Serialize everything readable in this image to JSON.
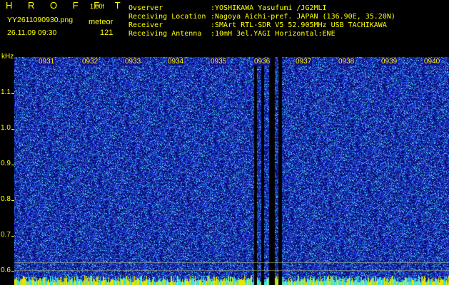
{
  "header": {
    "brand": "H R O F F T",
    "version": "1.00f",
    "filename": "YY2611090930.png",
    "observation_type": "meteor",
    "datetime": "26.11.09 09:30",
    "count": "121"
  },
  "info": [
    {
      "label": "Ovserver",
      "value": ":YOSHIKAWA Yasufumi /JG2MLI"
    },
    {
      "label": "Receiving Location",
      "value": ":Nagoya Aichi-pref. JAPAN (136.90E, 35.20N)"
    },
    {
      "label": "Receiver",
      "value": ":SMArt RTL-SDR V5 52.905MHz USB TACHIKAWA"
    },
    {
      "label": "Receiving Antenna",
      "value": ":10mH 3el.YAGI Horizontal:ENE"
    }
  ],
  "spectrogram": {
    "unit": "kHz",
    "y_labels": [
      "1.1",
      "1.0",
      "0.9",
      "0.8",
      "0.7",
      "0.6"
    ],
    "time_labels": [
      "0931",
      "0932",
      "0933",
      "0934",
      "0935",
      "0936",
      "0937",
      "0938",
      "0939",
      "0940"
    ],
    "colors": {
      "background": "#000000",
      "text": "#ffff00",
      "noise_low": "#0a0a7a",
      "noise_mid": "#2a3ad0",
      "noise_high": "#4fe3e3"
    }
  }
}
